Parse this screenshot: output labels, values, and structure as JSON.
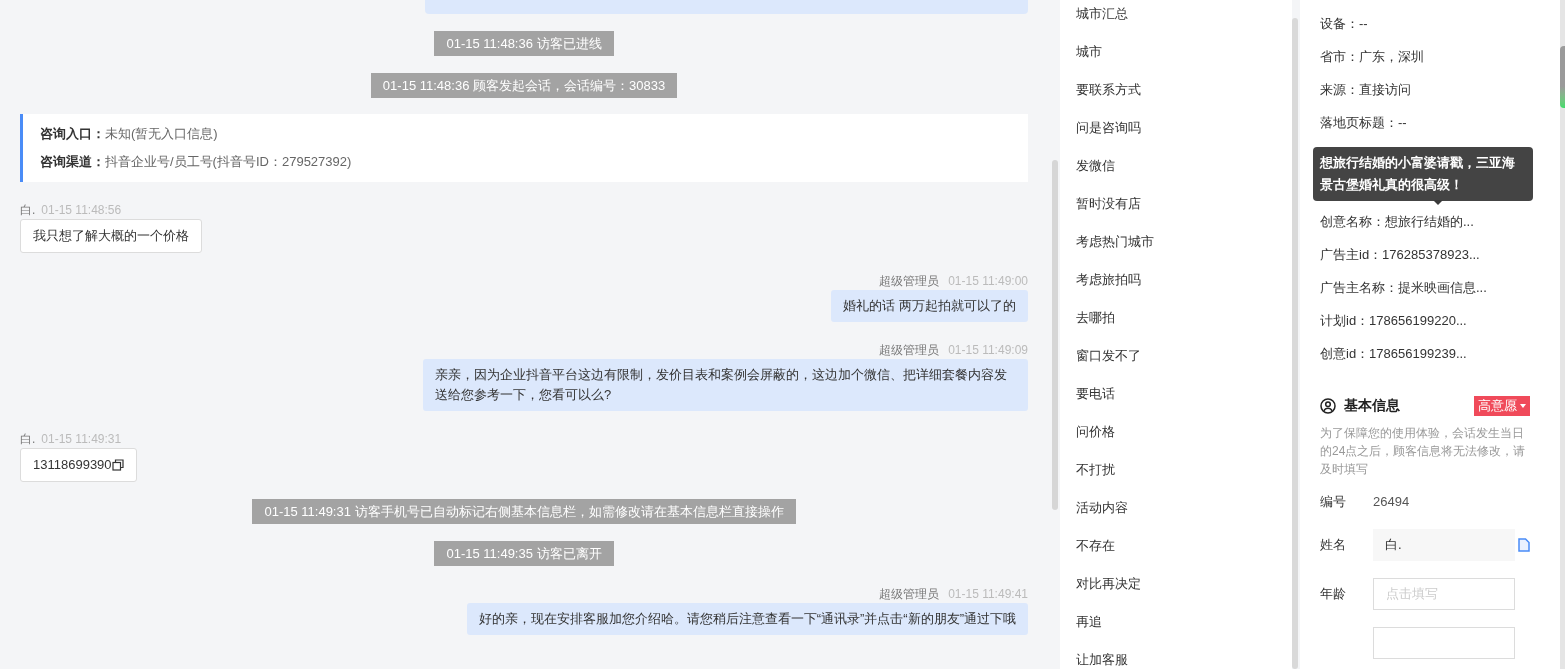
{
  "chat": {
    "messages": [
      {
        "kind": "agent_cut"
      },
      {
        "kind": "system",
        "text": "01-15 11:48:36 访客已进线"
      },
      {
        "kind": "system",
        "text": "01-15 11:48:36 顾客发起会话，会话编号：30833"
      },
      {
        "kind": "entry",
        "rows": [
          {
            "label": "咨询入口：",
            "value": "未知(暂无入口信息)"
          },
          {
            "label": "咨询渠道：",
            "value": "抖音企业号/员工号(抖音号ID：279527392)"
          }
        ]
      },
      {
        "kind": "visitor",
        "name": "白.",
        "time": "01-15 11:48:56",
        "text": "我只想了解大概的一个价格",
        "copyable": false
      },
      {
        "kind": "agent",
        "name": "超级管理员",
        "time": "01-15 11:49:00",
        "text": "婚礼的话 两万起拍就可以了的"
      },
      {
        "kind": "agent",
        "name": "超级管理员",
        "time": "01-15 11:49:09",
        "text": "亲亲，因为企业抖音平台这边有限制，发价目表和案例会屏蔽的，这边加个微信、把详细套餐内容发送给您参考一下，您看可以么?"
      },
      {
        "kind": "visitor",
        "name": "白.",
        "time": "01-15 11:49:31",
        "text": "13118699390",
        "copyable": true
      },
      {
        "kind": "system",
        "text": "01-15 11:49:31 访客手机号已自动标记右侧基本信息栏，如需修改请在基本信息栏直接操作"
      },
      {
        "kind": "system",
        "text": "01-15 11:49:35 访客已离开"
      },
      {
        "kind": "agent",
        "name": "超级管理员",
        "time": "01-15 11:49:41",
        "text": "好的亲，现在安排客服加您介绍哈。请您稍后注意查看一下“通讯录”并点击“新的朋友”通过下哦"
      }
    ]
  },
  "quick_replies": [
    "城市汇总",
    "城市",
    "要联系方式",
    "问是咨询吗",
    "发微信",
    "暂时没有店",
    "考虑热门城市",
    "考虑旅拍吗",
    "去哪拍",
    "窗口发不了",
    "要电话",
    "问价格",
    "不打扰",
    "活动内容",
    "不存在",
    "对比再决定",
    "再追",
    "让加客服"
  ],
  "profile": {
    "rows_top": [
      "设备：--",
      "省市：广东，深圳",
      "来源：直接访问",
      "落地页标题：--"
    ],
    "tooltip": "想旅行结婚的小富婆请戳，三亚海景古堡婚礼真的很高级！",
    "rows_bottom": [
      "创意名称：想旅行结婚的...",
      "广告主id：176285378923...",
      "广告主名称：提米映画信息...",
      "计划id：178656199220...",
      "创意id：178656199239..."
    ],
    "basic_info": {
      "title": "基本信息",
      "tag": "高意愿",
      "notice": "为了保障您的使用体验，会话发生当日的24点之后，顾客信息将无法修改，请及时填写",
      "fields": [
        {
          "kind": "text",
          "label": "编号",
          "value": "26494"
        },
        {
          "kind": "input",
          "label": "姓名",
          "value": "白.",
          "copy": true
        },
        {
          "kind": "input",
          "label": "年龄",
          "placeholder": "点击填写",
          "copy": false
        },
        {
          "kind": "input",
          "copy": false
        }
      ]
    }
  }
}
